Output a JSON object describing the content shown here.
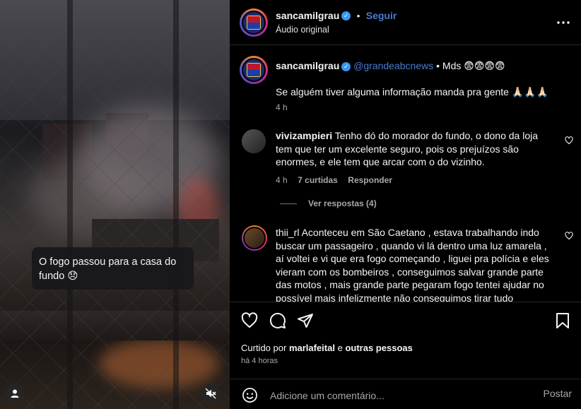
{
  "media": {
    "caption": "O fogo passou para a casa do fundo 😞",
    "user_icon": "user-icon",
    "mute_icon": "volume-muted-icon"
  },
  "header": {
    "username": "sancamilgrau",
    "separator": "•",
    "follow_label": "Seguir",
    "subtitle": "Áudio original",
    "more_icon": "more-horizontal-icon"
  },
  "post_caption": {
    "username": "sancamilgrau",
    "mention": "@grandeabcnews",
    "text_after_mention": "• Mds 😨😨😨😨",
    "body": "Se alguém tiver alguma informação manda pra gente 🙏🏻🙏🏻🙏🏻",
    "time": "4 h"
  },
  "comments": [
    {
      "username": "vivizampieri",
      "text": "Tenho dó do morador do fundo, o dono da loja tem que ter um excelente seguro, pois os prejuízos são enormes, e ele tem que arcar com o do vizinho.",
      "time": "4 h",
      "likes": "7 curtidas",
      "reply_label": "Responder",
      "view_replies": "Ver respostas (4)"
    },
    {
      "username": "thii_rl",
      "text": "Aconteceu em São Caetano , estava trabalhando indo buscar um passageiro , quando vi lá dentro uma luz amarela , aí voltei e vi que era fogo começando , liguei pra polícia e eles vieram com os bombeiros , conseguimos salvar grande parte das motos , mais grande parte pegaram fogo tentei ajudar no possível mais infelizmente não conseguimos tirar tudo"
    }
  ],
  "actions": {
    "liked_prefix": "Curtido por",
    "liked_user": "marlafeital",
    "liked_and": "e",
    "liked_others": "outras pessoas",
    "time": "há 4 horas"
  },
  "comment_box": {
    "placeholder": "Adicione um comentário...",
    "post_label": "Postar"
  },
  "colors": {
    "background": "#000000",
    "link_blue": "#4a7bd0",
    "verified_blue": "#3897f0",
    "muted_text": "#a8a8a8"
  }
}
